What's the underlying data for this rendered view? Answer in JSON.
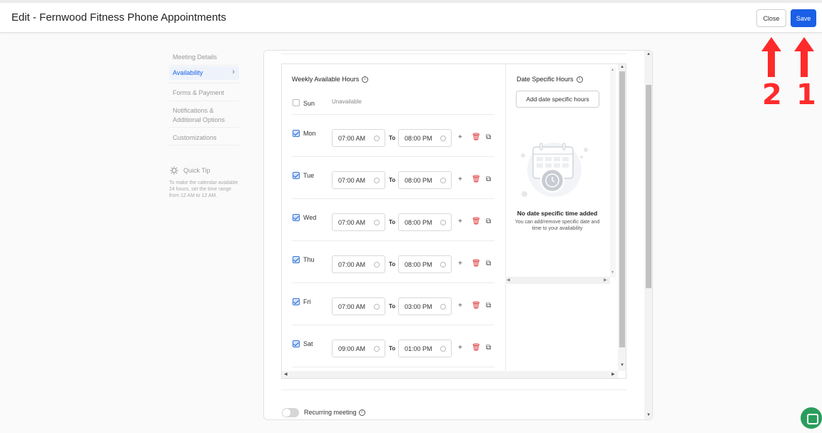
{
  "header": {
    "title": "Edit - Fernwood Fitness Phone Appointments",
    "close_label": "Close",
    "save_label": "Save"
  },
  "sidebar": {
    "items": [
      {
        "label": "Meeting Details"
      },
      {
        "label": "Availability"
      },
      {
        "label": "Forms & Payment"
      },
      {
        "label": "Notifications & Additional Options"
      },
      {
        "label": "Customizations"
      }
    ],
    "active_index": 1,
    "tip_title": "Quick Tip",
    "tip_text": "To make the calendar available 24 hours, set the time range from 12 AM to 12 AM."
  },
  "weekly": {
    "title": "Weekly Available Hours",
    "to_label": "To",
    "unavailable_label": "Unavailable",
    "days": [
      {
        "name": "Sun",
        "checked": false
      },
      {
        "name": "Mon",
        "checked": true,
        "from": "07:00 AM",
        "to": "08:00 PM"
      },
      {
        "name": "Tue",
        "checked": true,
        "from": "07:00 AM",
        "to": "08:00 PM"
      },
      {
        "name": "Wed",
        "checked": true,
        "from": "07:00 AM",
        "to": "08:00 PM"
      },
      {
        "name": "Thu",
        "checked": true,
        "from": "07:00 AM",
        "to": "08:00 PM"
      },
      {
        "name": "Fri",
        "checked": true,
        "from": "07:00 AM",
        "to": "03:00 PM"
      },
      {
        "name": "Sat",
        "checked": true,
        "from": "09:00 AM",
        "to": "01:00 PM"
      }
    ]
  },
  "date_specific": {
    "title": "Date Specific Hours",
    "button_label": "Add date specific hours",
    "empty_title": "No date specific time added",
    "empty_text": "You can add/remove specific date and time to your availability"
  },
  "recurring": {
    "label": "Recurring meeting",
    "enabled": false
  },
  "annotations": [
    {
      "number": "1"
    },
    {
      "number": "2"
    }
  ],
  "colors": {
    "accent": "#1a5fe6",
    "annotation": "#ff2b2b",
    "chat": "#2a9d5c"
  }
}
